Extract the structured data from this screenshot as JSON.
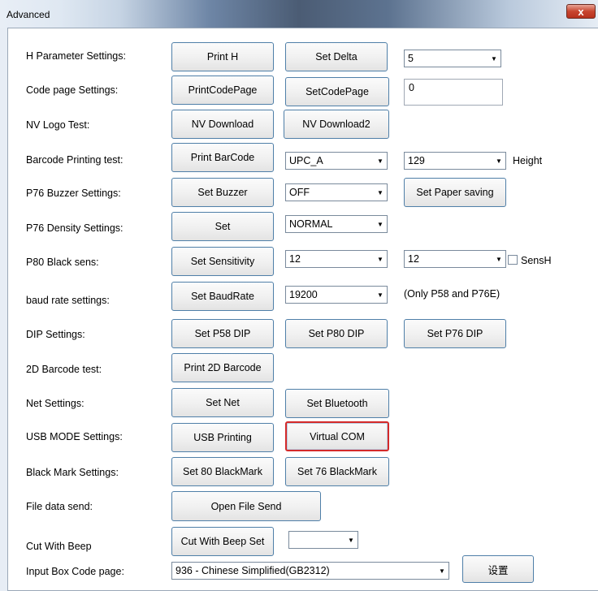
{
  "window": {
    "title": "Advanced",
    "close_label": "x"
  },
  "rows": {
    "h_param": {
      "label": "H Parameter Settings:",
      "btn1": "Print H",
      "btn2": "Set Delta",
      "combo": "5"
    },
    "code_page": {
      "label": "Code page Settings:",
      "btn1": "PrintCodePage",
      "btn2": "SetCodePage",
      "input": "0"
    },
    "nv_logo": {
      "label": "NV Logo Test:",
      "btn1": "NV Download",
      "btn2": "NV Download2"
    },
    "barcode": {
      "label": "Barcode Printing test:",
      "btn1": "Print BarCode",
      "combo1": "UPC_A",
      "combo2": "129",
      "suffix": "Height"
    },
    "buzzer": {
      "label": "P76 Buzzer Settings:",
      "btn1": "Set Buzzer",
      "combo": "OFF",
      "btn2": "Set Paper saving"
    },
    "density": {
      "label": "P76 Density Settings:",
      "btn1": "Set",
      "combo": "NORMAL"
    },
    "black_sens": {
      "label": "P80 Black sens:",
      "btn1": "Set Sensitivity",
      "combo1": "12",
      "combo2": "12",
      "check_label": "SensH"
    },
    "baud": {
      "label": "baud rate settings:",
      "btn1": "Set BaudRate",
      "combo": "19200",
      "note": "(Only P58 and P76E)"
    },
    "dip": {
      "label": "DIP Settings:",
      "btn1": "Set P58 DIP",
      "btn2": "Set P80 DIP",
      "btn3": "Set P76 DIP"
    },
    "barcode2d": {
      "label": "2D Barcode test:",
      "btn1": "Print 2D Barcode"
    },
    "net": {
      "label": "Net Settings:",
      "btn1": "Set Net",
      "btn2": "Set Bluetooth"
    },
    "usb": {
      "label": "USB MODE Settings:",
      "btn1": "USB Printing",
      "btn2": "Virtual COM"
    },
    "black_mark": {
      "label": "Black Mark Settings:",
      "btn1": "Set 80 BlackMark",
      "btn2": "Set 76 BlackMark"
    },
    "file_send": {
      "label": "File data send:",
      "btn1": "Open File Send"
    },
    "cut_beep": {
      "label": "Cut With Beep",
      "btn1": "Cut With Beep Set",
      "combo": ""
    },
    "input_cp": {
      "label": "Input Box Code page:",
      "combo": "936 - Chinese Simplified(GB2312)",
      "btn1": "设置"
    }
  }
}
